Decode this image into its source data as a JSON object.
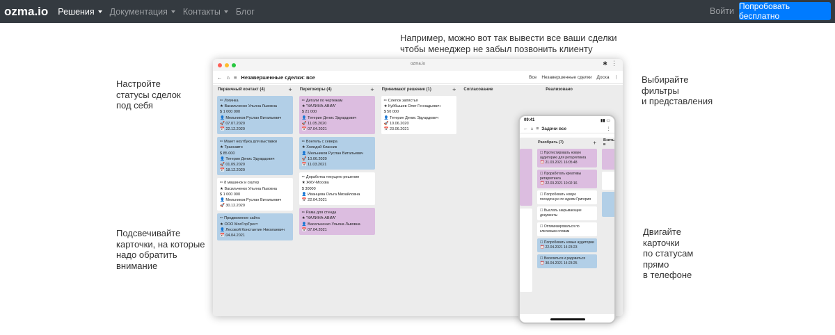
{
  "nav": {
    "brand": "ozma.io",
    "items": [
      {
        "label": "Решения",
        "active": true,
        "dropdown": true
      },
      {
        "label": "Документация",
        "active": false,
        "dropdown": true
      },
      {
        "label": "Контакты",
        "active": false,
        "dropdown": true
      },
      {
        "label": "Блог",
        "active": false,
        "dropdown": false
      }
    ],
    "login": "Войти",
    "try_button": "Попробовать бесплатно",
    "accent": "#007bff"
  },
  "captions": {
    "top": "Например, можно вот так вывести все ваши сделки\nчтобы менеджер не забыл позвонить клиенту",
    "statuses": "Настройте\nстатусы сделок\nпод себя",
    "filters": "Выбирайте\nфильтры\nи представления",
    "highlight": "Подсвечивайте\nкарточки, на которые\nнадо обратить\nвнимание",
    "mobile": "Двигайте\nкарточки\nпо статусам\nпрямо\nв телефоне"
  },
  "desktop": {
    "url": "ozma.io",
    "title": "Незавершенные сделки: все",
    "controls": [
      "Все",
      "Незавершенные сделки",
      "Доска"
    ],
    "columns": [
      {
        "title": "Первичный контакт (4)",
        "cards": [
          {
            "color": "blue",
            "lines": [
              "✏ Логинка",
              "★ Васильченко Ульяна Львовна",
              "$ 1 000 000",
              "👤 Мельников Руслан Витальевич",
              "🚀 07.07.2020",
              "📅 22.12.2020"
            ]
          },
          {
            "color": "blue",
            "lines": [
              "✏ Макет ноутбука для выставки",
              "★ Трансавто",
              "$ 85 000",
              "👤 Тетерин Денис Эдуардович",
              "🚀 01.09.2020",
              "📅 18.12.2020"
            ]
          },
          {
            "color": "white",
            "lines": [
              "✏ 8 машинок и скутер",
              "★ Васильченко Ульяна Львовна",
              "$ 1 000 000",
              "👤 Мельников Руслан Витальевич",
              "🚀 30.12.2020"
            ]
          },
          {
            "color": "blue",
            "lines": [
              "✏ Продвижение сайта",
              "★ ООО МосГорТрест",
              "👤 Лесовой Константин Николаевич",
              "📅 04.04.2021"
            ]
          }
        ]
      },
      {
        "title": "Переговоры (4)",
        "cards": [
          {
            "color": "purple",
            "lines": [
              "✏ Детали по чертежам",
              "★ \"КАЛИНА-АВИА\"",
              "$ 21 000",
              "👤 Тетерин Денис Эдуардович",
              "🚀 11.05.2020",
              "📅 07.04.2021"
            ]
          },
          {
            "color": "blue",
            "lines": [
              "✏ Вонтель с севера",
              "★ Холидэй Классик",
              "👤 Мельников Руслан Витальевич",
              "🚀 10.06.2020",
              "📅 11.03.2021"
            ]
          },
          {
            "color": "white",
            "lines": [
              "✏ Доработка текущего решения",
              "★ ЖКУ-Москва",
              "$ 30000",
              "👤 Иванцева Ольга Михайловна",
              "📅 22.04.2021"
            ]
          },
          {
            "color": "purple",
            "lines": [
              "✏ Рама для стенда",
              "★ \"КАЛИНА-АВИА\"",
              "👤 Васильченко Ульяна Львовна",
              "📅 07.04.2021"
            ]
          }
        ]
      },
      {
        "title": "Принимают решение (1)",
        "cards": [
          {
            "color": "white",
            "lines": [
              "✏ Слепок запястья",
              "★ Куйбышев Олег Геннадьевич",
              "$ 50 000",
              "👤 Тетерин Денис Эдуардович",
              "🚀 10.06.2020",
              "📅 23.06.2021"
            ]
          }
        ]
      },
      {
        "title": "Согласование",
        "cards": []
      },
      {
        "title": "Реализовано",
        "cards": []
      }
    ]
  },
  "phone": {
    "time": "09:41",
    "title": "Задачи все",
    "column_title": "Разобрать (7)",
    "next_column": "Взять в",
    "cards": [
      {
        "color": "purple",
        "lines": [
          "☐ Протестировать новую аудиторию для ретаргетинга",
          "⏰ 21.03.2021 16:05:48"
        ]
      },
      {
        "color": "purple",
        "lines": [
          "☐ Проработать креативы ретаргетинга",
          "⏰ 22.03.2021 10:02:16"
        ]
      },
      {
        "color": "white",
        "lines": [
          "☐ Попробовать новую посадочную по идеям Григория"
        ]
      },
      {
        "color": "white",
        "lines": [
          "☐ Выслать закрывающие документы"
        ]
      },
      {
        "color": "white",
        "lines": [
          "☐ Оптимизироваться по ключевым словам"
        ]
      },
      {
        "color": "blue",
        "lines": [
          "☐ Попробовать новые аудитории",
          "⏰ 22.04.2021 14:23:23"
        ]
      },
      {
        "color": "blue",
        "lines": [
          "☐ Веселиться и радоваться",
          "⏰ 30.04.2021 14:23:25"
        ]
      }
    ]
  }
}
